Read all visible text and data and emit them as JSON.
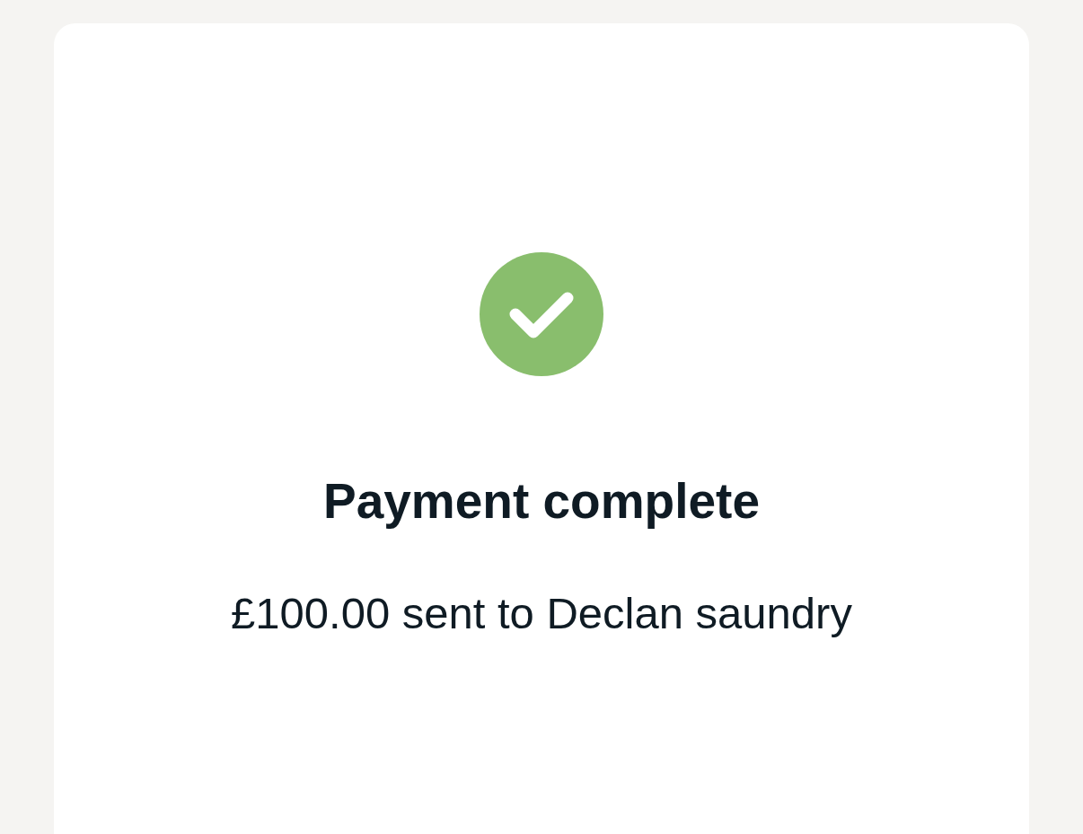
{
  "status": {
    "kind": "success",
    "title": "Payment complete",
    "message": "£100.00 sent to Declan saundry"
  }
}
